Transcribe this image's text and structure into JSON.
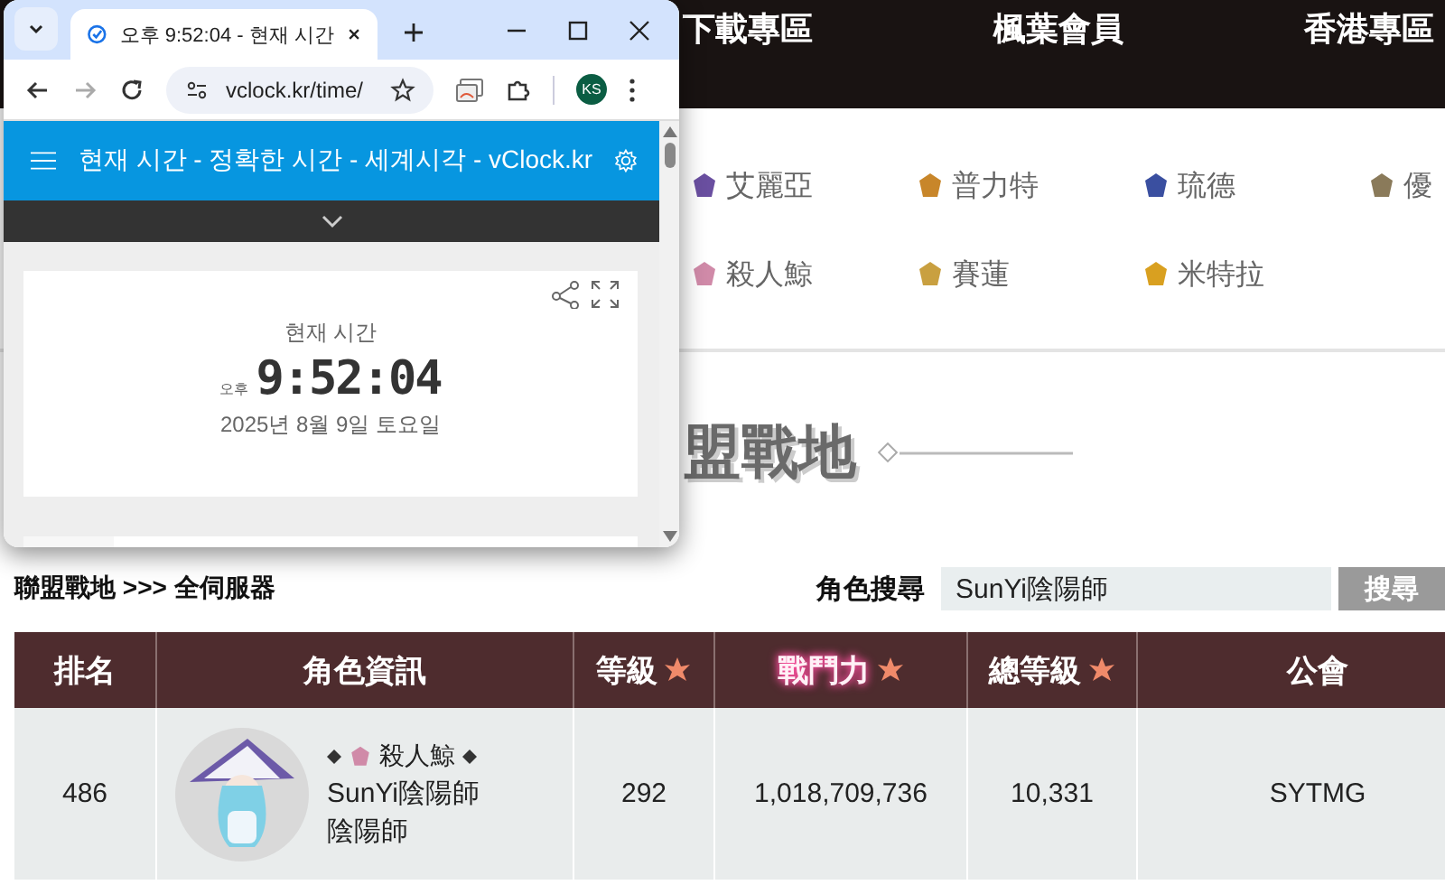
{
  "browser_window": {
    "tab_title": "오후 9:52:04 - 현재 시간",
    "url": "vclock.kr/time/",
    "profile_initials": "KS",
    "site_header": {
      "title": "현재 시간 - 정확한 시간 - 세계시각 - vClock.kr"
    },
    "clock_card": {
      "label": "현재 시간",
      "ampm": "오후",
      "time": "9:52:04",
      "date": "2025년 8월 9일 토요일"
    }
  },
  "page": {
    "nav": [
      "下載專區",
      "楓葉會員",
      "香港專區"
    ],
    "servers": [
      {
        "name": "艾麗亞",
        "color": "#6a4fa0"
      },
      {
        "name": "普力特",
        "color": "#c8862a"
      },
      {
        "name": "琉德",
        "color": "#3a4fa0"
      },
      {
        "name": "優",
        "color": "#8a7a5a"
      },
      {
        "name": "殺人鯨",
        "color": "#d08aa8"
      },
      {
        "name": "賽蓮",
        "color": "#c9a040"
      },
      {
        "name": "米特拉",
        "color": "#d9a020"
      }
    ],
    "section_title": "盟戰地",
    "breadcrumb": "聯盟戰地 >>> 全伺服器",
    "search": {
      "label": "角色搜尋",
      "value": "SunYi陰陽師",
      "button": "搜尋"
    },
    "table": {
      "columns": [
        {
          "label": "排名",
          "sortable": false,
          "highlighted": false
        },
        {
          "label": "角色資訊",
          "sortable": false,
          "highlighted": false
        },
        {
          "label": "等級",
          "sortable": true,
          "highlighted": false
        },
        {
          "label": "戰鬥力",
          "sortable": true,
          "highlighted": true
        },
        {
          "label": "總等級",
          "sortable": true,
          "highlighted": false
        },
        {
          "label": "公會",
          "sortable": false,
          "highlighted": false
        }
      ],
      "rows": [
        {
          "rank": "486",
          "server": {
            "name": "殺人鯨",
            "color": "#d08aa8"
          },
          "name": "SunYi陰陽師",
          "job": "陰陽師",
          "level": "292",
          "power": "1,018,709,736",
          "total_level": "10,331",
          "guild": "SYTMG"
        }
      ]
    }
  }
}
